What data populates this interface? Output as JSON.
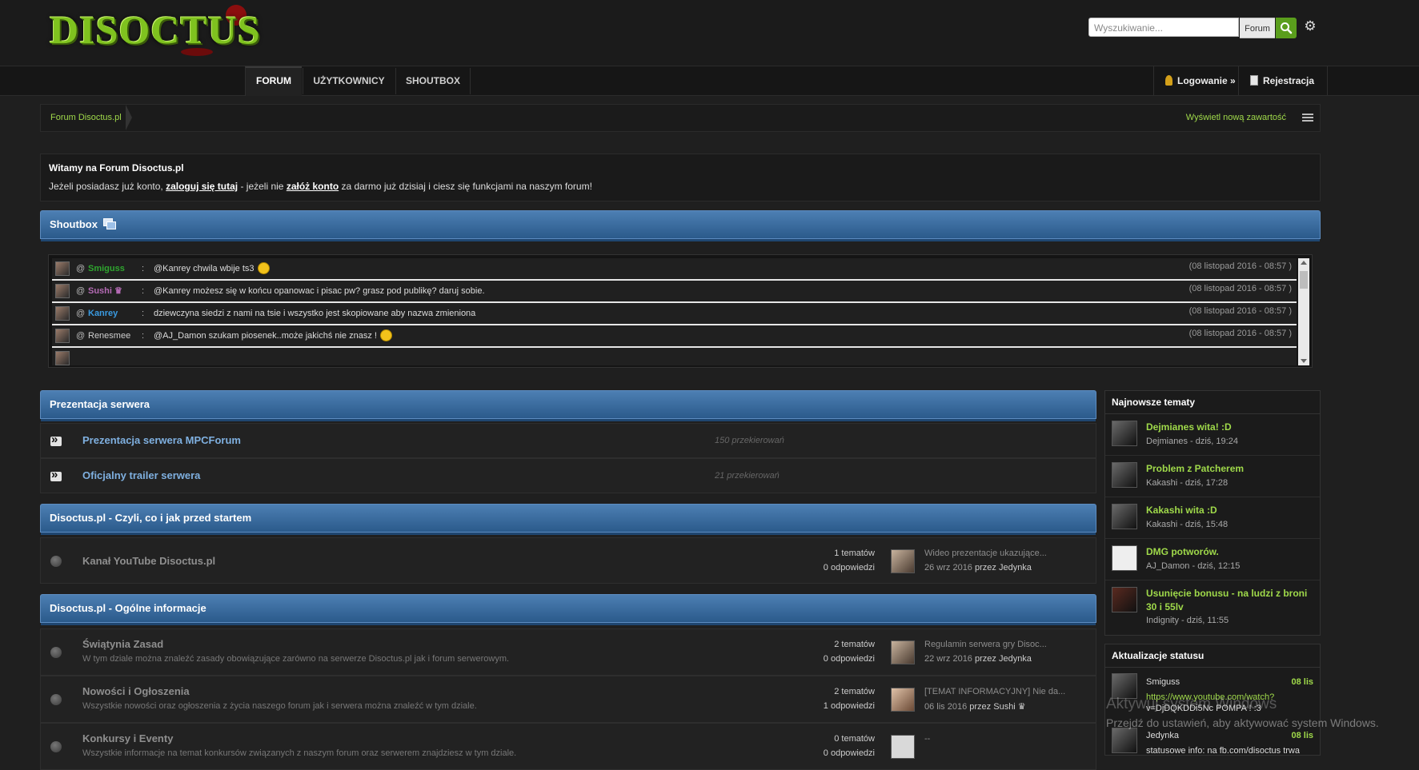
{
  "header": {
    "logo_text": "DISOCTUS",
    "search_placeholder": "Wyszukiwanie...",
    "search_scope": "Forum",
    "search_icon": "search-icon",
    "settings_icon": "gear-icon"
  },
  "nav": {
    "tabs": [
      {
        "label": "FORUM",
        "active": true
      },
      {
        "label": "UŻYTKOWNICY",
        "active": false
      },
      {
        "label": "SHOUTBOX",
        "active": false
      }
    ],
    "login": "Logowanie »",
    "register": "Rejestracja"
  },
  "breadcrumb": {
    "home": "Forum Disoctus.pl",
    "new_content": "Wyświetl nową zawartość"
  },
  "welcome": {
    "title": "Witamy na Forum Disoctus.pl",
    "text_1": "Jeżeli posiadasz już konto, ",
    "link_login": "zaloguj się tutaj",
    "text_2": " - jeżeli nie ",
    "link_register": "załóż konto",
    "text_3": " za darmo już dzisiaj i ciesz się funkcjami na naszym forum!"
  },
  "shoutbox": {
    "title": "Shoutbox",
    "shouts": [
      {
        "at": "@",
        "user": "Smiguss",
        "user_color": "#2fa52f",
        "colon": ":",
        "message": "@Kanrey chwila wbije ts3",
        "emoji": true,
        "time": "(08 listopad 2016 - 08:57 )"
      },
      {
        "at": "@",
        "user": "Sushi ♛",
        "user_color": "#b46ab4",
        "colon": ":",
        "message": "@Kanrey możesz się w końcu opanowac i pisac pw? grasz pod publikę? daruj sobie.",
        "emoji": false,
        "time": "(08 listopad 2016 - 08:57 )"
      },
      {
        "at": "@",
        "user": "Kanrey",
        "user_color": "#3a9ae0",
        "colon": ":",
        "message": "dziewczyna siedzi z nami na tsie i wszystko jest skopiowane aby nazwa zmieniona",
        "emoji": false,
        "time": "(08 listopad 2016 - 08:57 )"
      },
      {
        "at": "@",
        "user": "Renesmee",
        "user_color": "#cfcfcf",
        "colon": ":",
        "message": "@AJ_Damon szukam piosenek..może jakichś nie znasz !",
        "emoji": true,
        "time": "(08 listopad 2016 - 08:57 )"
      }
    ]
  },
  "sections": {
    "prezentacja": {
      "title": "Prezentacja serwera",
      "rows": [
        {
          "title": "Prezentacja serwera MPCForum",
          "count": "150 przekierowań"
        },
        {
          "title": "Oficjalny trailer serwera",
          "count": "21 przekierowań"
        }
      ]
    },
    "start": {
      "title": "Disoctus.pl - Czyli, co i jak przed startem",
      "rows": [
        {
          "title": "Kanał YouTube Disoctus.pl",
          "topics": "1 tematów",
          "replies": "0 odpowiedzi",
          "last_title": "Wideo prezentacje ukazujące...",
          "last_date": "26 wrz 2016",
          "last_by": "przez Jedynka"
        }
      ]
    },
    "info": {
      "title": "Disoctus.pl - Ogólne informacje",
      "rows": [
        {
          "title": "Świątynia Zasad",
          "desc": "W tym dziale można znaleźć zasady obowiązujące zarówno na serwerze Disoctus.pl jak i forum serwerowym.",
          "topics": "2 tematów",
          "replies": "0 odpowiedzi",
          "last_title": "Regulamin serwera gry Disoc...",
          "last_date": "22 wrz 2016",
          "last_by": "przez Jedynka"
        },
        {
          "title": "Nowości i Ogłoszenia",
          "desc": "Wszystkie nowości oraz ogłoszenia z życia naszego forum jak i serwera można znaleźć w tym dziale.",
          "topics": "2 tematów",
          "replies": "1 odpowiedzi",
          "last_title": "[TEMAT INFORMACYJNY] Nie da...",
          "last_date": "06 lis 2016",
          "last_by": "przez Sushi ♛"
        },
        {
          "title": "Konkursy i Eventy",
          "desc": "Wszystkie informacje na temat konkursów związanych z naszym forum oraz serwerem znajdziesz w tym dziale.",
          "topics": "0 tematów",
          "replies": "0 odpowiedzi",
          "last_title": "--",
          "last_date": "",
          "last_by": ""
        }
      ]
    }
  },
  "sidebar": {
    "latest_title": "Najnowsze tematy",
    "topics": [
      {
        "title": "Dejmianes wita! :D",
        "meta": "Dejmianes - dziś, 19:24"
      },
      {
        "title": "Problem z Patcherem",
        "meta": "Kakashi - dziś, 17:28"
      },
      {
        "title": "Kakashi wita :D",
        "meta": "Kakashi - dziś, 15:48"
      },
      {
        "title": "DMG potworów.",
        "meta": "AJ_Damon - dziś, 12:15"
      },
      {
        "title": "Usunięcie bonusu - na ludzi z broni 30 i 55lv",
        "meta": "Indignity - dziś, 11:55"
      }
    ],
    "status_title": "Aktualizacje statusu",
    "statuses": [
      {
        "name": "Smiguss",
        "date": "08 lis",
        "text": "https://www.youtube.com/watch?",
        "text2": "v=DjDQKDDi5Nc POMPA ! :3"
      },
      {
        "name": "Jedynka",
        "date": "08 lis",
        "text2": "statusowe info: na fb.com/disoctus trwa"
      }
    ]
  },
  "os_watermark": {
    "line1": "Aktywuj system Windows",
    "line2": "Przejdź do ustawień, aby aktywować system Windows."
  }
}
